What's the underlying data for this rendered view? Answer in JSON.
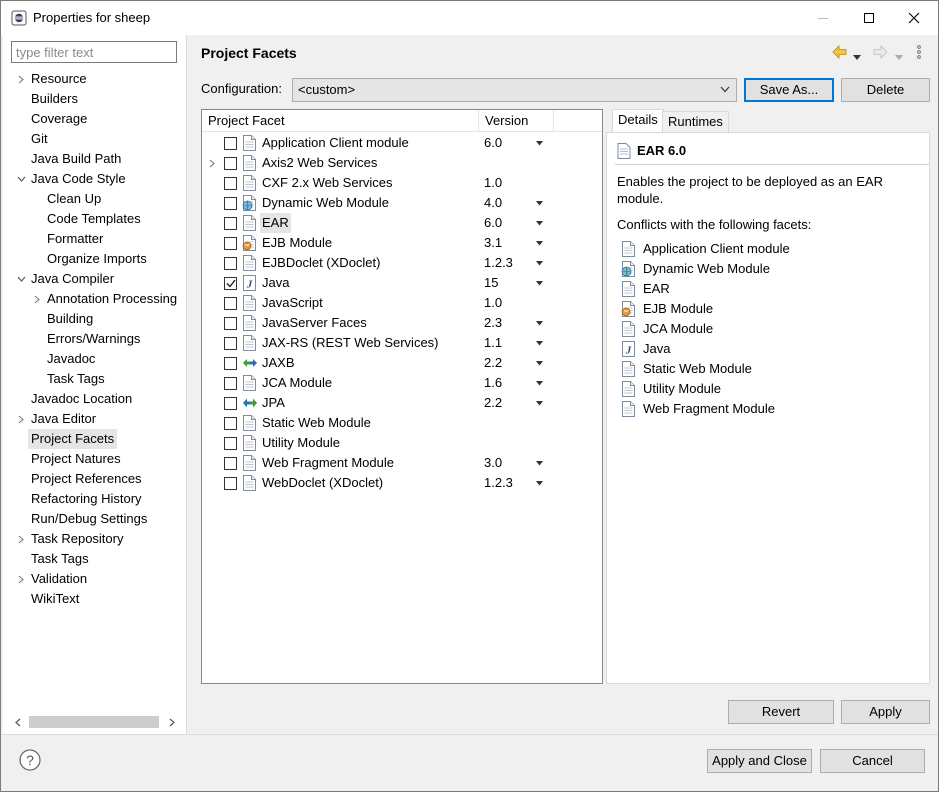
{
  "window": {
    "title": "Properties for sheep",
    "minimize_icon": "minimize-icon",
    "maximize_icon": "maximize-icon",
    "close_icon": "close-icon"
  },
  "filter": {
    "placeholder": "type filter text"
  },
  "tree": [
    {
      "label": "Resource",
      "expander": "collapsed"
    },
    {
      "label": "Builders"
    },
    {
      "label": "Coverage"
    },
    {
      "label": "Git"
    },
    {
      "label": "Java Build Path"
    },
    {
      "label": "Java Code Style",
      "expander": "expanded"
    },
    {
      "label": "Clean Up",
      "child": true
    },
    {
      "label": "Code Templates",
      "child": true
    },
    {
      "label": "Formatter",
      "child": true
    },
    {
      "label": "Organize Imports",
      "child": true
    },
    {
      "label": "Java Compiler",
      "expander": "expanded"
    },
    {
      "label": "Annotation Processing",
      "child": true,
      "expander": "collapsed"
    },
    {
      "label": "Building",
      "child": true
    },
    {
      "label": "Errors/Warnings",
      "child": true
    },
    {
      "label": "Javadoc",
      "child": true
    },
    {
      "label": "Task Tags",
      "child": true
    },
    {
      "label": "Javadoc Location"
    },
    {
      "label": "Java Editor",
      "expander": "collapsed"
    },
    {
      "label": "Project Facets",
      "selected": true
    },
    {
      "label": "Project Natures"
    },
    {
      "label": "Project References"
    },
    {
      "label": "Refactoring History"
    },
    {
      "label": "Run/Debug Settings"
    },
    {
      "label": "Task Repository",
      "expander": "collapsed"
    },
    {
      "label": "Task Tags"
    },
    {
      "label": "Validation",
      "expander": "collapsed"
    },
    {
      "label": "WikiText"
    }
  ],
  "page": {
    "title": "Project Facets"
  },
  "configuration": {
    "label": "Configuration:",
    "value": "<custom>",
    "save_as": "Save As...",
    "delete": "Delete"
  },
  "facets_table": {
    "col_facet": "Project Facet",
    "col_version": "Version",
    "rows": [
      {
        "name": "Application Client module",
        "version": "6.0",
        "dropdown": true,
        "checked": false,
        "icon": "page-icon"
      },
      {
        "name": "Axis2 Web Services",
        "version": "",
        "dropdown": false,
        "checked": false,
        "icon": "page-icon",
        "expandable": true
      },
      {
        "name": "CXF 2.x Web Services",
        "version": "1.0",
        "dropdown": false,
        "checked": false,
        "icon": "page-icon"
      },
      {
        "name": "Dynamic Web Module",
        "version": "4.0",
        "dropdown": true,
        "checked": false,
        "icon": "globe-page-icon"
      },
      {
        "name": "EAR",
        "version": "6.0",
        "dropdown": true,
        "checked": false,
        "icon": "page-icon",
        "highlighted": true
      },
      {
        "name": "EJB Module",
        "version": "3.1",
        "dropdown": true,
        "checked": false,
        "icon": "bean-page-icon"
      },
      {
        "name": "EJBDoclet (XDoclet)",
        "version": "1.2.3",
        "dropdown": true,
        "checked": false,
        "icon": "page-icon"
      },
      {
        "name": "Java",
        "version": "15",
        "dropdown": true,
        "checked": true,
        "icon": "java-icon"
      },
      {
        "name": "JavaScript",
        "version": "1.0",
        "dropdown": false,
        "checked": false,
        "icon": "page-icon"
      },
      {
        "name": "JavaServer Faces",
        "version": "2.3",
        "dropdown": true,
        "checked": false,
        "icon": "page-icon"
      },
      {
        "name": "JAX-RS (REST Web Services)",
        "version": "1.1",
        "dropdown": true,
        "checked": false,
        "icon": "page-icon"
      },
      {
        "name": "JAXB",
        "version": "2.2",
        "dropdown": true,
        "checked": false,
        "icon": "jaxb-icon"
      },
      {
        "name": "JCA Module",
        "version": "1.6",
        "dropdown": true,
        "checked": false,
        "icon": "page-icon"
      },
      {
        "name": "JPA",
        "version": "2.2",
        "dropdown": true,
        "checked": false,
        "icon": "jpa-icon"
      },
      {
        "name": "Static Web Module",
        "version": "",
        "dropdown": false,
        "checked": false,
        "icon": "page-icon"
      },
      {
        "name": "Utility Module",
        "version": "",
        "dropdown": false,
        "checked": false,
        "icon": "page-icon"
      },
      {
        "name": "Web Fragment Module",
        "version": "3.0",
        "dropdown": true,
        "checked": false,
        "icon": "page-icon"
      },
      {
        "name": "WebDoclet (XDoclet)",
        "version": "1.2.3",
        "dropdown": true,
        "checked": false,
        "icon": "page-icon"
      }
    ]
  },
  "details": {
    "tab_details": "Details",
    "tab_runtimes": "Runtimes",
    "title": "EAR 6.0",
    "description": "Enables the project to be deployed as an EAR module.",
    "conflicts_label": "Conflicts with the following facets:",
    "conflicts": [
      {
        "name": "Application Client module",
        "icon": "page-icon"
      },
      {
        "name": "Dynamic Web Module",
        "icon": "globe-page-icon"
      },
      {
        "name": "EAR",
        "icon": "page-icon"
      },
      {
        "name": "EJB Module",
        "icon": "bean-page-icon"
      },
      {
        "name": "JCA Module",
        "icon": "page-icon"
      },
      {
        "name": "Java",
        "icon": "java-icon"
      },
      {
        "name": "Static Web Module",
        "icon": "page-icon"
      },
      {
        "name": "Utility Module",
        "icon": "page-icon"
      },
      {
        "name": "Web Fragment Module",
        "icon": "page-icon"
      }
    ]
  },
  "buttons": {
    "revert": "Revert",
    "apply": "Apply",
    "apply_close": "Apply and Close",
    "cancel": "Cancel"
  },
  "colors": {
    "accent": "#0078d7",
    "selection": "#e5e5e5",
    "dialog_bg": "#f0f0f0"
  }
}
